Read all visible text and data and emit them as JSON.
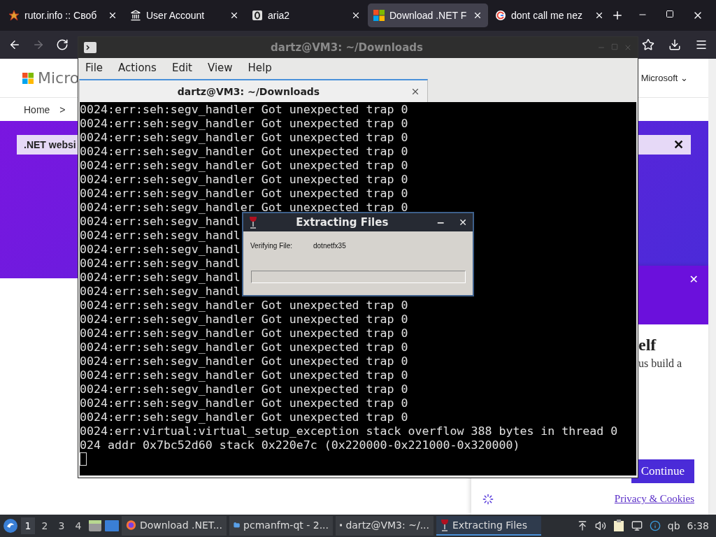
{
  "browser": {
    "tabs": [
      {
        "label": "rutor.info :: Своб",
        "selected": false
      },
      {
        "label": "User Account",
        "selected": false
      },
      {
        "label": "aria2",
        "selected": false
      },
      {
        "label": "Download .NET F",
        "selected": true
      },
      {
        "label": "dont call me nez",
        "selected": false
      }
    ],
    "forward_disabled": true,
    "page": {
      "logo_text": "Micro",
      "account_menu": "Microsoft ⌄",
      "breadcrumb": [
        "Home",
        ">"
      ],
      "notice": ".NET websi",
      "notice_close": "✕",
      "cookie_panel": {
        "close": "✕",
        "heading": "elf",
        "text": "us build a",
        "button": "Continue",
        "link": "Privacy & Cookies"
      }
    }
  },
  "terminal": {
    "title": "dartz@VM3: ~/Downloads",
    "menu": [
      "File",
      "Actions",
      "Edit",
      "View",
      "Help"
    ],
    "tabs": [
      {
        "label": "dartz@VM3: ~/Downloads",
        "selected": true
      }
    ],
    "lines": [
      "0024:err:seh:segv_handler Got unexpected trap 0",
      "0024:err:seh:segv_handler Got unexpected trap 0",
      "0024:err:seh:segv_handler Got unexpected trap 0",
      "0024:err:seh:segv_handler Got unexpected trap 0",
      "0024:err:seh:segv_handler Got unexpected trap 0",
      "0024:err:seh:segv_handler Got unexpected trap 0",
      "0024:err:seh:segv_handler Got unexpected trap 0",
      "0024:err:seh:segv_handler Got unexpected trap 0",
      "0024:err:seh:segv_handl",
      "0024:err:seh:segv_handl",
      "0024:err:seh:segv_handl",
      "0024:err:seh:segv_handl",
      "0024:err:seh:segv_handl",
      "0024:err:seh:segv_handl",
      "0024:err:seh:segv_handler Got unexpected trap 0",
      "0024:err:seh:segv_handler Got unexpected trap 0",
      "0024:err:seh:segv_handler Got unexpected trap 0",
      "0024:err:seh:segv_handler Got unexpected trap 0",
      "0024:err:seh:segv_handler Got unexpected trap 0",
      "0024:err:seh:segv_handler Got unexpected trap 0",
      "0024:err:seh:segv_handler Got unexpected trap 0",
      "0024:err:seh:segv_handler Got unexpected trap 0",
      "0024:err:seh:segv_handler Got unexpected trap 0",
      "0024:err:virtual:virtual_setup_exception stack overflow 388 bytes in thread 0",
      "024 addr 0x7bc52d60 stack 0x220e7c (0x220000-0x221000-0x320000)"
    ]
  },
  "dialog": {
    "title": "Extracting Files",
    "minimize": "−",
    "close": "✕",
    "label": "Verifying File:",
    "value": "dotnetfx35",
    "progress": {
      "level": 0
    }
  },
  "taskbar": {
    "workspaces": [
      {
        "label": "1",
        "selected": true
      },
      {
        "label": "2",
        "selected": false
      },
      {
        "label": "3",
        "selected": false
      },
      {
        "label": "4",
        "selected": false
      }
    ],
    "tasks": [
      {
        "label": "Download .NET...",
        "selected": false
      },
      {
        "label": "pcmanfm-qt - 2...",
        "selected": false
      },
      {
        "label": "dartz@VM3: ~/...",
        "selected": false
      },
      {
        "label": "Extracting Files",
        "selected": true
      }
    ],
    "tray_text": "qb",
    "clock": "6:38"
  }
}
